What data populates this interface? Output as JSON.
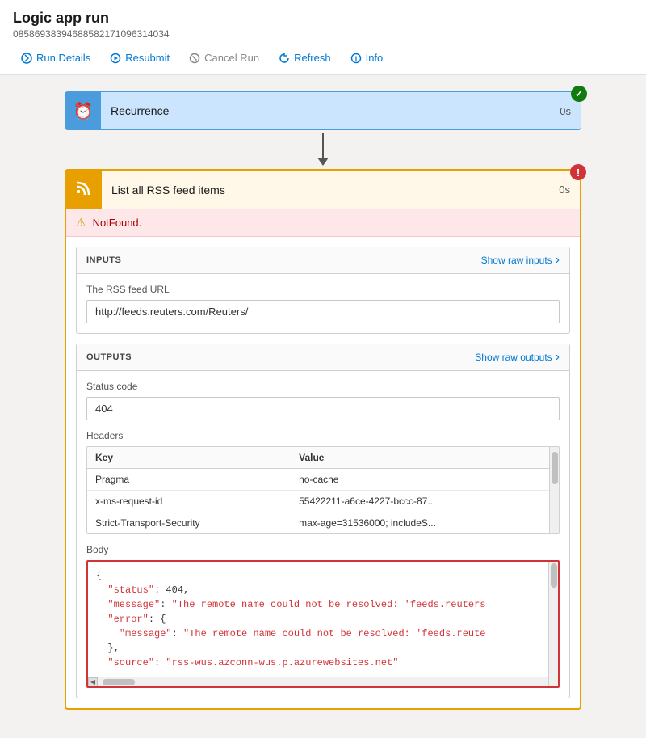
{
  "header": {
    "title": "Logic app run",
    "subtitle": "085869383946885821710963140 34",
    "subtitle_full": "08586938394688582171096314034"
  },
  "toolbar": {
    "run_details": "Run Details",
    "resubmit": "Resubmit",
    "cancel_run": "Cancel Run",
    "refresh": "Refresh",
    "info": "Info"
  },
  "recurrence": {
    "label": "Recurrence",
    "time": "0s",
    "status": "success"
  },
  "rss_block": {
    "label": "List all RSS feed items",
    "time": "0s",
    "status": "error",
    "error_message": "NotFound."
  },
  "inputs": {
    "section_title": "INPUTS",
    "show_raw_label": "Show raw inputs",
    "rss_url_label": "The RSS feed URL",
    "rss_url_value": "http://feeds.reuters.com/Reuters/"
  },
  "outputs": {
    "section_title": "OUTPUTS",
    "show_raw_label": "Show raw outputs",
    "status_code_label": "Status code",
    "status_code_value": "404",
    "headers_label": "Headers",
    "headers_columns": [
      "Key",
      "Value"
    ],
    "headers_rows": [
      {
        "key": "Pragma",
        "value": "no-cache"
      },
      {
        "key": "x-ms-request-id",
        "value": "55422211-a6ce-4227-bccc-87..."
      },
      {
        "key": "Strict-Transport-Security",
        "value": "max-age=31536000; includeS..."
      }
    ],
    "body_label": "Body",
    "body_lines": [
      {
        "text": "{",
        "type": "plain"
      },
      {
        "text": "  \"status\": 404,",
        "type": "number_key"
      },
      {
        "text": "  \"message\": \"The remote name could not be resolved: 'feeds.reuters",
        "type": "string_key"
      },
      {
        "text": "  \"error\": {",
        "type": "string_key"
      },
      {
        "text": "    \"message\": \"The remote name could not be resolved: 'feeds.reute",
        "type": "string_key"
      },
      {
        "text": "  },",
        "type": "plain"
      },
      {
        "text": "  \"source\": \"rss-wus.azconn-wus.p.azurewebsites.net\"",
        "type": "string_key"
      }
    ]
  }
}
